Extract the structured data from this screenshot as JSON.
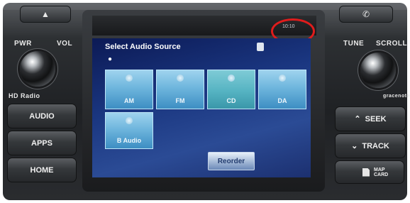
{
  "top_buttons": {
    "eject_glyph": "▲",
    "phone_glyph": "✆"
  },
  "left_panel": {
    "pwr_label": "PWR",
    "vol_label": "VOL",
    "hd_radio_label": "HD Radio",
    "buttons": [
      "AUDIO",
      "APPS",
      "HOME"
    ]
  },
  "right_panel": {
    "tune_label": "TUNE",
    "scroll_label": "SCROLL",
    "gracenote_label": "gracenote",
    "seek_label": "SEEK",
    "track_label": "TRACK",
    "map_card_label": "MAP\nCARD"
  },
  "screen": {
    "status_clock": "10:10",
    "title": "Select Audio Source",
    "tiles": [
      {
        "label": "AM"
      },
      {
        "label": "FM"
      },
      {
        "label": "CD"
      },
      {
        "label": "DA"
      },
      {
        "label": "B Audio"
      }
    ],
    "reorder_label": "Reorder"
  },
  "colors": {
    "highlight_circle": "#e01c1c",
    "tile": "#6fb6dd"
  }
}
